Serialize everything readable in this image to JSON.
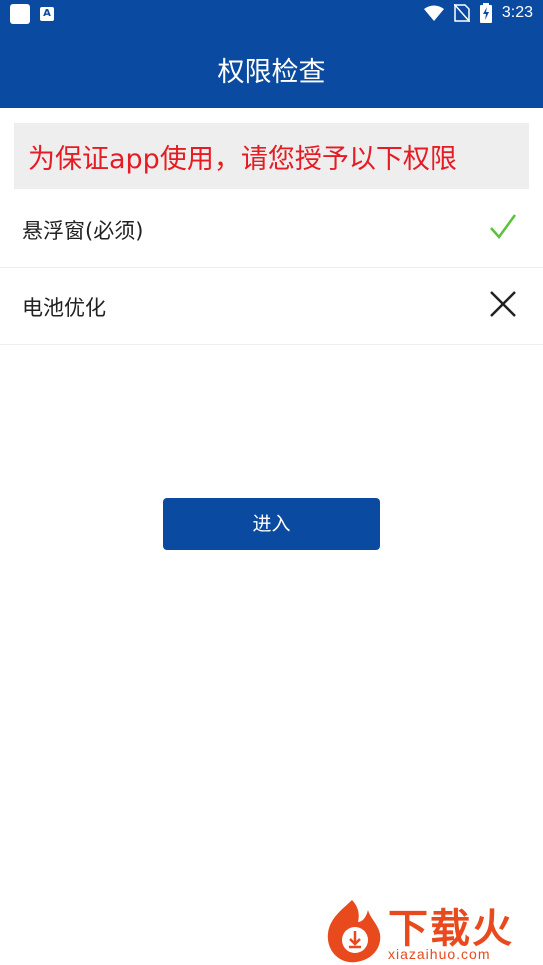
{
  "status_bar": {
    "time": "3:23",
    "icons": [
      "app-square-icon",
      "app-a-icon",
      "wifi-icon",
      "no-sim-icon",
      "battery-charging-icon"
    ]
  },
  "header": {
    "title": "权限检查"
  },
  "banner": {
    "text": "为保证app使用，请您授予以下权限"
  },
  "permissions": [
    {
      "label": "悬浮窗(必须)",
      "status": "granted",
      "icon": "check-icon",
      "color": "#5ac23b"
    },
    {
      "label": "电池优化",
      "status": "not-granted",
      "icon": "close-icon",
      "color": "#222222"
    }
  ],
  "enter_button": {
    "label": "进入"
  },
  "watermark": {
    "name": "下载火",
    "url": "xiazaihuo.com"
  },
  "colors": {
    "primary": "#0b4aa1",
    "warning_text": "#e51c23",
    "accent": "#e8491d"
  }
}
